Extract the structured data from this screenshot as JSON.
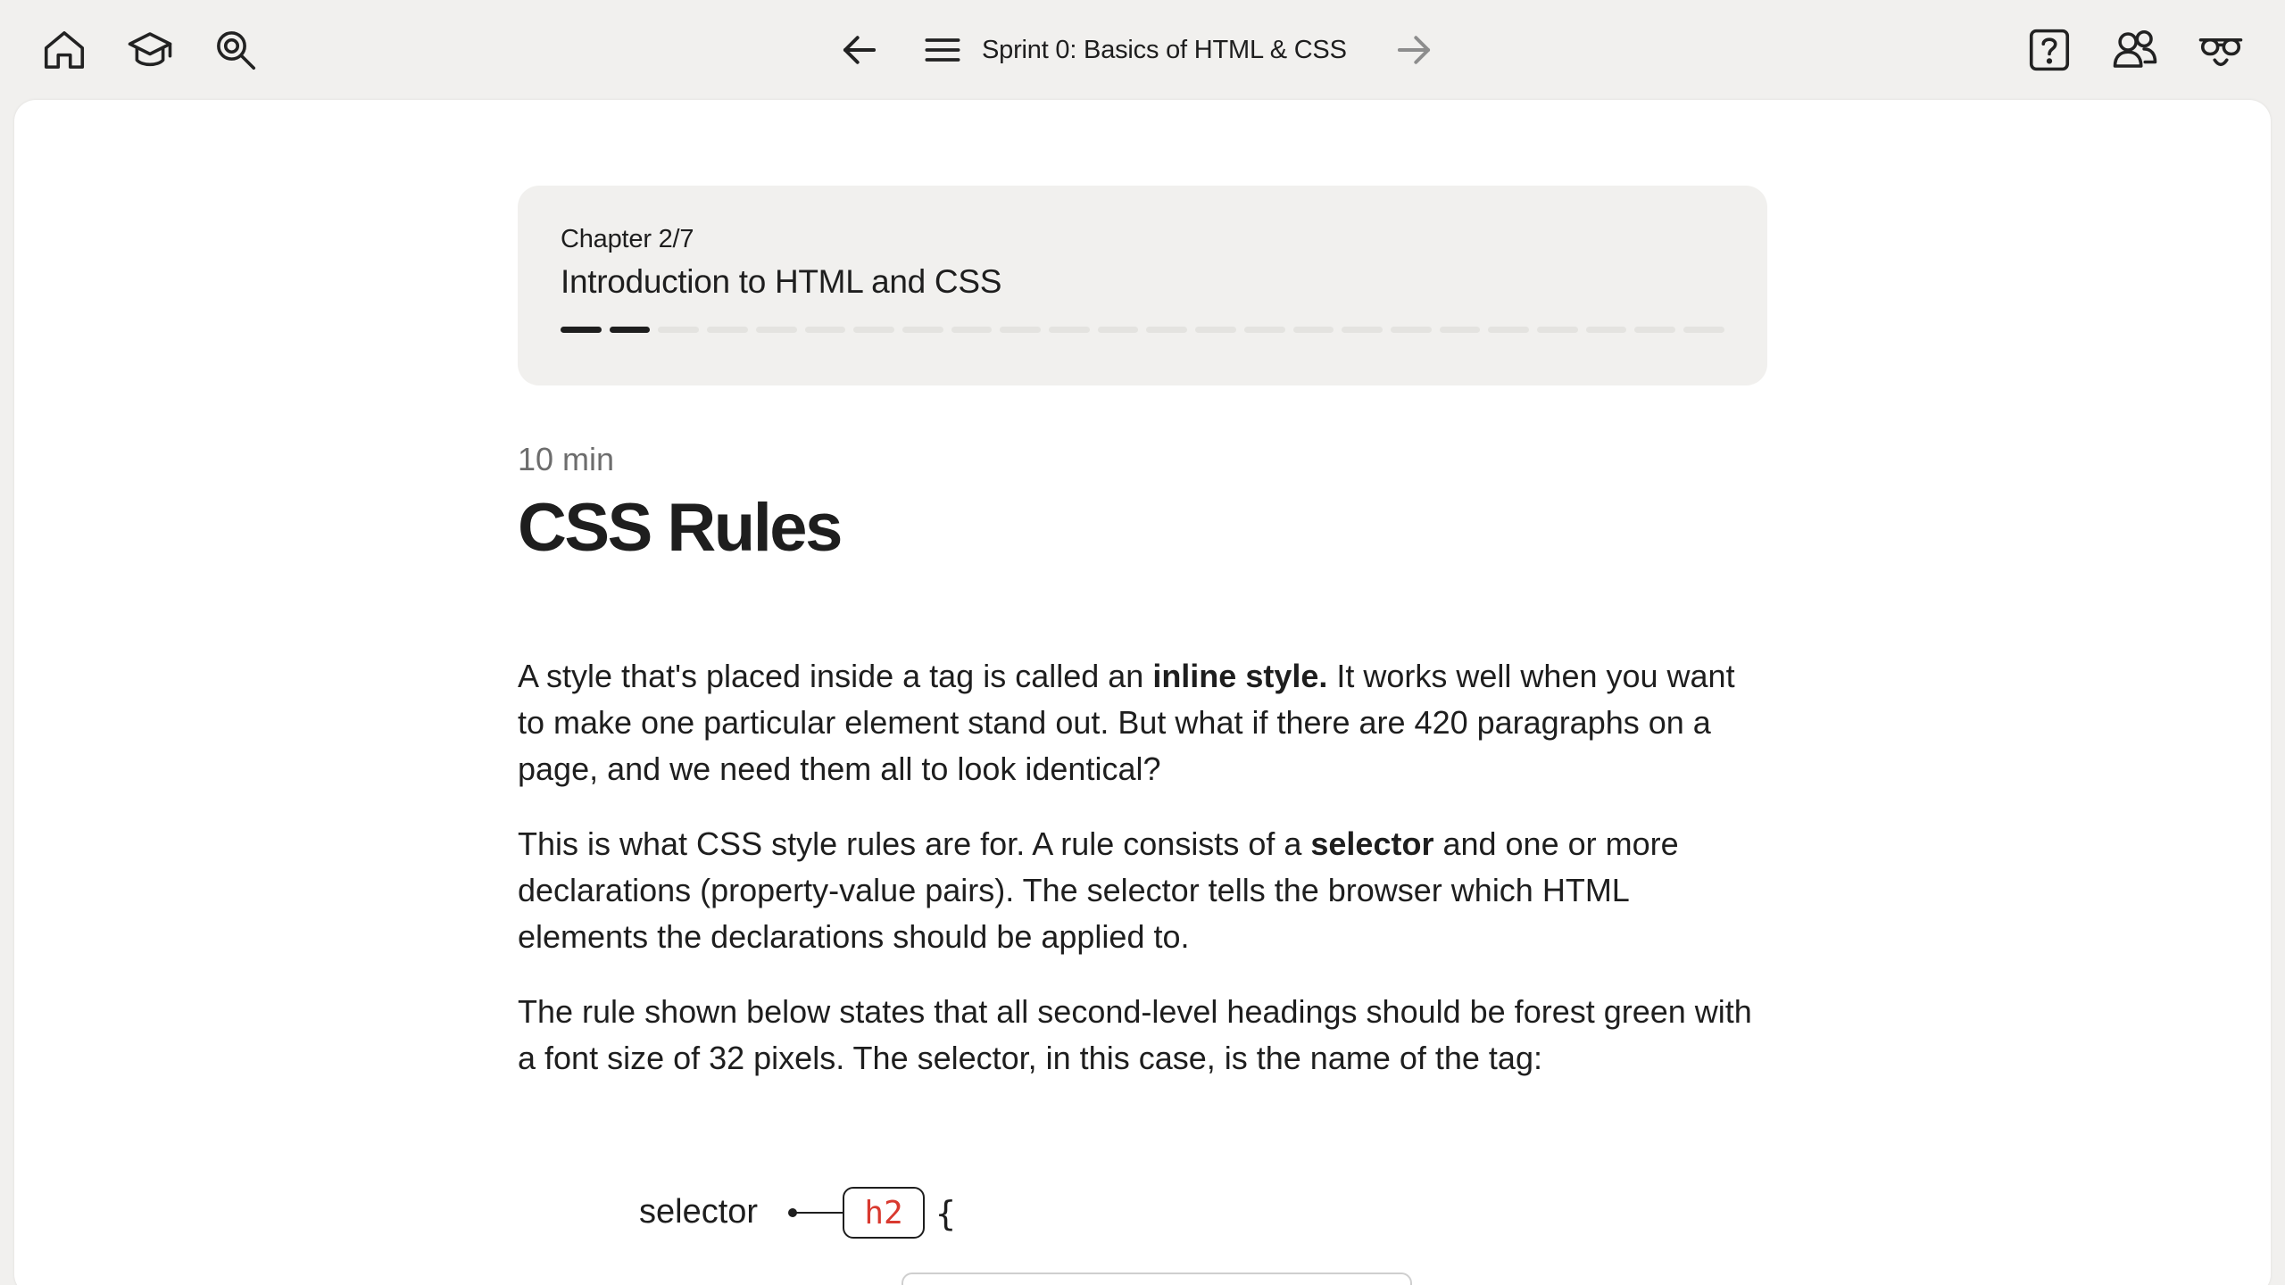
{
  "topbar": {
    "left_icons": [
      "home-icon",
      "graduation-cap-icon",
      "search-icon"
    ],
    "right_icons": [
      "help-icon",
      "community-icon",
      "reviewer-icon"
    ],
    "sprint_title": "Sprint 0: Basics of HTML & CSS"
  },
  "chapter": {
    "number": "Chapter 2/7",
    "title": "Introduction to HTML and CSS",
    "progress": {
      "completed": 2,
      "total": 24
    }
  },
  "lesson": {
    "duration": "10 min",
    "title": "CSS Rules",
    "paragraphs": [
      {
        "p1_a": "A style that's placed inside a tag is called an ",
        "p1_bold": "inline style.",
        "p1_b": " It works well when you want to make one particular element stand out. But what if there are 420 paragraphs on a page, and we need them all to look identical?"
      },
      {
        "p2_a": "This is what CSS style rules are for. A rule consists of a ",
        "p2_bold": "selector",
        "p2_b": " and one or more declarations (property-value pairs). The selector tells the browser which HTML elements the declarations should be applied to."
      },
      {
        "p3": "The rule shown below states that all second-level headings should be forest green with a font size of 32 pixels. The selector, in this case, is the name of the tag:"
      }
    ]
  },
  "diagram": {
    "selector_label": "selector",
    "selector_code": "h2",
    "open_brace": "{",
    "colors": {
      "code": "#d9392f"
    }
  }
}
